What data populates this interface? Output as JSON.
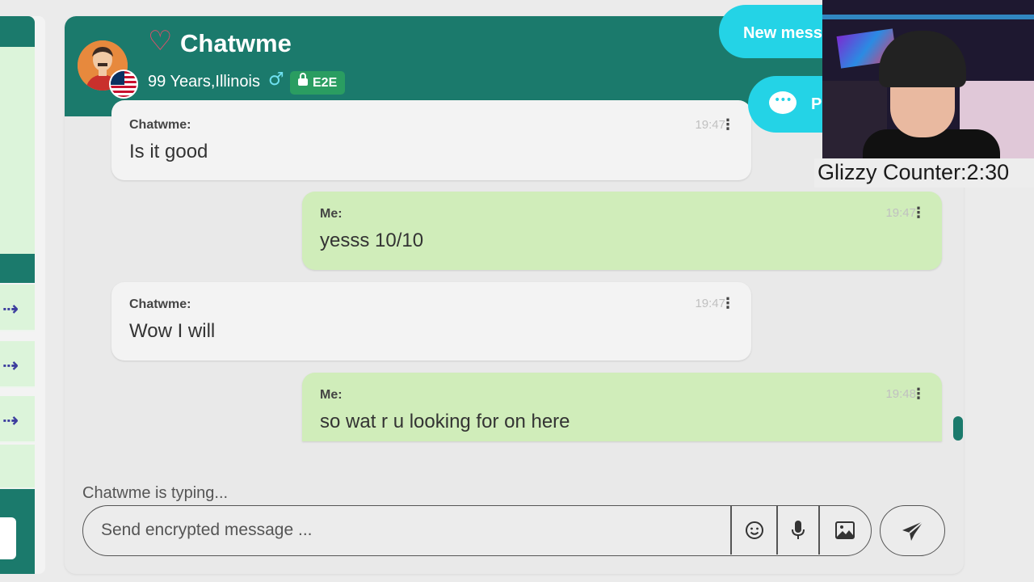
{
  "sidebar": {
    "items": [
      {
        "icon": "arrow-right-icon"
      },
      {
        "icon": "arrow-right-icon"
      },
      {
        "icon": "arrow-right-icon"
      }
    ]
  },
  "header": {
    "title": "Chatwme",
    "subtitle": "99 Years,Illinois",
    "gender_symbol": "♂",
    "badge": "E2E",
    "colors": {
      "accent": "#1b7a6c",
      "heart": "#e84d6a",
      "badge": "#2a9d61"
    }
  },
  "floating": {
    "new_message_label": "New mess",
    "p_label": "P",
    "color": "#24d3e6"
  },
  "messages": [
    {
      "sender": "Chatwme:",
      "text": "Is it good",
      "time": "19:47",
      "direction": "in"
    },
    {
      "sender": "Me:",
      "text": "yesss 10/10",
      "time": "19:47",
      "direction": "out"
    },
    {
      "sender": "Chatwme:",
      "text": "Wow I will",
      "time": "19:47",
      "direction": "in"
    },
    {
      "sender": "Me:",
      "text": "so wat r u looking for on here",
      "time": "19:48",
      "direction": "out"
    }
  ],
  "status": {
    "typing": "Chatwme is typing..."
  },
  "composer": {
    "placeholder": "Send encrypted message ..."
  },
  "overlay": {
    "counter": "Glizzy Counter:2:30"
  }
}
